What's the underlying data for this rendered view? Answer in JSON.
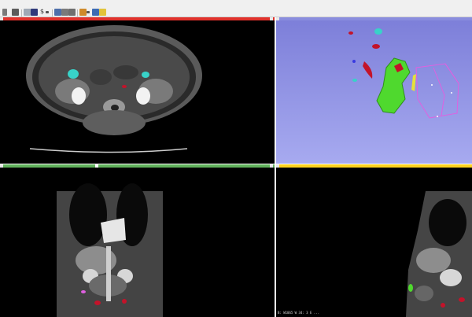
{
  "toolbar": {
    "zoom_indicator": "$"
  },
  "views": {
    "red": {
      "color": "#e0322c"
    },
    "yellow": {
      "color": "#ffd21f",
      "annotation": "B: W1065 W 34: 3 E ..."
    },
    "green": {
      "color": "#61b25c"
    },
    "threed": {
      "color": "#8a8dde"
    }
  },
  "colors": {
    "segment_green": "#4fd92e",
    "segment_red": "#c3132a",
    "segment_cyan": "#38d2c8",
    "segment_yellow": "#e6e13a",
    "segment_pink": "#e060e0"
  }
}
